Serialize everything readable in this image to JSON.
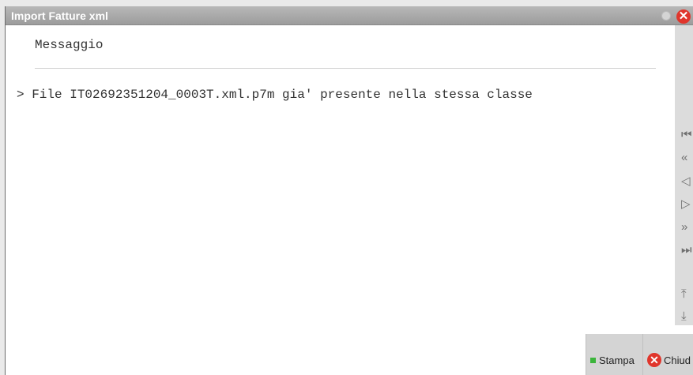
{
  "window": {
    "title": "Import Fatture xml",
    "close_glyph": "✕",
    "min_icon": "circle-icon",
    "close_icon": "close-icon"
  },
  "message": {
    "heading": "Messaggio",
    "line": "> File IT02692351204_0003T.xml.p7m gia' presente nella stessa classe"
  },
  "nav": {
    "first": "⏮",
    "prev_page": "«",
    "prev": "◁",
    "next": "▷",
    "next_page": "»",
    "last": "⏭",
    "top": "⤒",
    "bottom": "⤓"
  },
  "footer": {
    "stampa_label": "Stampa",
    "chiudi_label": "Chiud",
    "chiudi_glyph": "✕"
  },
  "colors": {
    "title_bar": "#a8a8a8",
    "close_red": "#e0352b",
    "stampa_green": "#3bb53b"
  }
}
